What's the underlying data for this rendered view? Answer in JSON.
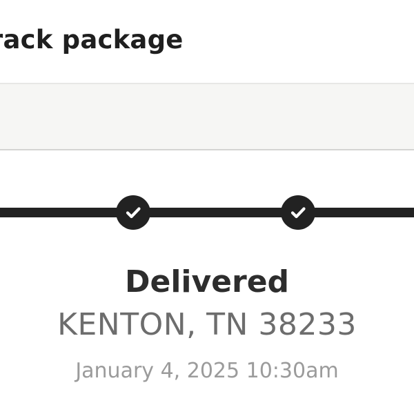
{
  "header": {
    "title": "rack package"
  },
  "tracking": {
    "status": "Delivered",
    "location": "KENTON, TN 38233",
    "timestamp": "January 4, 2025 10:30am",
    "steps": [
      {
        "icon": "checkmark-icon",
        "completed": true
      },
      {
        "icon": "checkmark-icon",
        "completed": true
      }
    ]
  },
  "colors": {
    "progress": "#222222",
    "band": "#f6f6f4",
    "status_text": "#2d2d2d",
    "location_text": "#6d6d6d",
    "timestamp_text": "#9b9b9b"
  }
}
